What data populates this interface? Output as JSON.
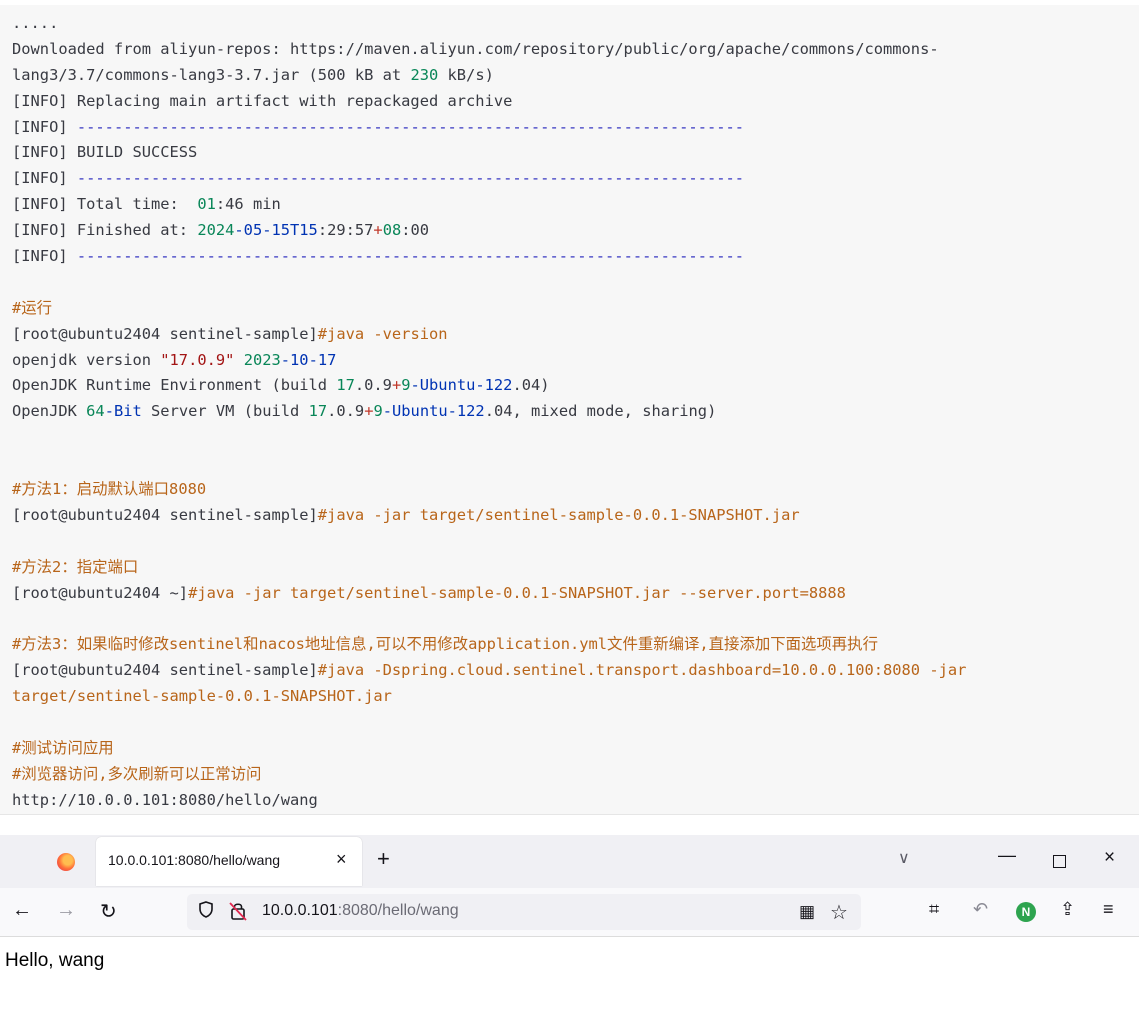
{
  "terminal": {
    "lines": [
      [
        {
          "t": "....."
        }
      ],
      [
        {
          "t": "Downloaded from aliyun-repos: https://maven.aliyun.com/repository/public/org/apache/commons/commons-"
        }
      ],
      [
        {
          "t": "lang3/3.7/commons-lang3-3.7.jar (500 kB at "
        },
        {
          "t": "230",
          "c": "c-num"
        },
        {
          "t": " kB/s)"
        }
      ],
      [
        {
          "t": "[INFO] Replacing main artifact with repackaged archive"
        }
      ],
      [
        {
          "t": "[INFO] "
        },
        {
          "t": "------------------------------------------------------------------------",
          "c": "c-dash"
        }
      ],
      [
        {
          "t": "[INFO] BUILD SUCCESS"
        }
      ],
      [
        {
          "t": "[INFO] "
        },
        {
          "t": "------------------------------------------------------------------------",
          "c": "c-dash"
        }
      ],
      [
        {
          "t": "[INFO] Total time:  "
        },
        {
          "t": "01",
          "c": "c-num"
        },
        {
          "t": ":46 min"
        }
      ],
      [
        {
          "t": "[INFO] Finished at: "
        },
        {
          "t": "2024",
          "c": "c-num"
        },
        {
          "t": "-05-15T15",
          "c": "c-kw"
        },
        {
          "t": ":29:57"
        },
        {
          "t": "+",
          "c": "c-red"
        },
        {
          "t": "08",
          "c": "c-num"
        },
        {
          "t": ":00"
        }
      ],
      [
        {
          "t": "[INFO] "
        },
        {
          "t": "------------------------------------------------------------------------",
          "c": "c-dash"
        }
      ],
      [
        {
          "t": ""
        }
      ],
      [
        {
          "t": "#运行",
          "c": "c-cmt"
        }
      ],
      [
        {
          "t": "[root@ubuntu2404 sentinel-sample]"
        },
        {
          "t": "#java -version",
          "c": "c-cmd"
        }
      ],
      [
        {
          "t": "openjdk version "
        },
        {
          "t": "\"17.0.9\"",
          "c": "c-str"
        },
        {
          "t": " "
        },
        {
          "t": "2023",
          "c": "c-num"
        },
        {
          "t": "-10-17",
          "c": "c-kw"
        }
      ],
      [
        {
          "t": "OpenJDK Runtime Environment (build "
        },
        {
          "t": "17",
          "c": "c-num"
        },
        {
          "t": ".0.9"
        },
        {
          "t": "+",
          "c": "c-red"
        },
        {
          "t": "9",
          "c": "c-num"
        },
        {
          "t": "-Ubuntu-122",
          "c": "c-kw"
        },
        {
          "t": ".04)"
        }
      ],
      [
        {
          "t": "OpenJDK "
        },
        {
          "t": "64",
          "c": "c-num"
        },
        {
          "t": "-Bit",
          "c": "c-kw"
        },
        {
          "t": " Server VM (build "
        },
        {
          "t": "17",
          "c": "c-num"
        },
        {
          "t": ".0.9"
        },
        {
          "t": "+",
          "c": "c-red"
        },
        {
          "t": "9",
          "c": "c-num"
        },
        {
          "t": "-Ubuntu-122",
          "c": "c-kw"
        },
        {
          "t": ".04, mixed mode, sharing)"
        }
      ],
      [
        {
          "t": ""
        }
      ],
      [
        {
          "t": ""
        }
      ],
      [
        {
          "t": "#方法1：启动默认端口8080",
          "c": "c-cmt"
        }
      ],
      [
        {
          "t": "[root@ubuntu2404 sentinel-sample]"
        },
        {
          "t": "#java -jar target/sentinel-sample-0.0.1-SNAPSHOT.jar",
          "c": "c-cmd"
        }
      ],
      [
        {
          "t": ""
        }
      ],
      [
        {
          "t": "#方法2：指定端口",
          "c": "c-cmt"
        }
      ],
      [
        {
          "t": "[root@ubuntu2404 ~]"
        },
        {
          "t": "#java -jar target/sentinel-sample-0.0.1-SNAPSHOT.jar --server.port=8888",
          "c": "c-cmd"
        }
      ],
      [
        {
          "t": ""
        }
      ],
      [
        {
          "t": "#方法3：如果临时修改sentinel和nacos地址信息,可以不用修改application.yml文件重新编译,直接添加下面选项再执行",
          "c": "c-cmt"
        }
      ],
      [
        {
          "t": "[root@ubuntu2404 sentinel-sample]"
        },
        {
          "t": "#java -Dspring.cloud.sentinel.transport.dashboard=10.0.0.100:8080 -jar",
          "c": "c-cmd"
        }
      ],
      [
        {
          "t": "target/sentinel-sample-0.0.1-SNAPSHOT.jar",
          "c": "c-cmd"
        }
      ],
      [
        {
          "t": ""
        }
      ],
      [
        {
          "t": "#测试访问应用",
          "c": "c-cmt"
        }
      ],
      [
        {
          "t": "#浏览器访问,多次刷新可以正常访问",
          "c": "c-cmt"
        }
      ],
      [
        {
          "t": "http://10.0.0.101:8080/hello/wang"
        }
      ]
    ]
  },
  "browser": {
    "tab_title": "10.0.0.101:8080/hello/wang",
    "tab_close": "×",
    "new_tab": "+",
    "tabs_menu": "∨",
    "win_min": "—",
    "win_close": "×",
    "back": "←",
    "forward": "→",
    "reload": "↻",
    "url_host": "10.0.0.101",
    "url_rest": ":8080/hello/wang",
    "qr": "▦",
    "star": "☆",
    "crop": "⌗",
    "undo": "↶",
    "ext_n": "N",
    "share": "⇪",
    "menu": "≡",
    "page_text": "Hello, wang"
  }
}
